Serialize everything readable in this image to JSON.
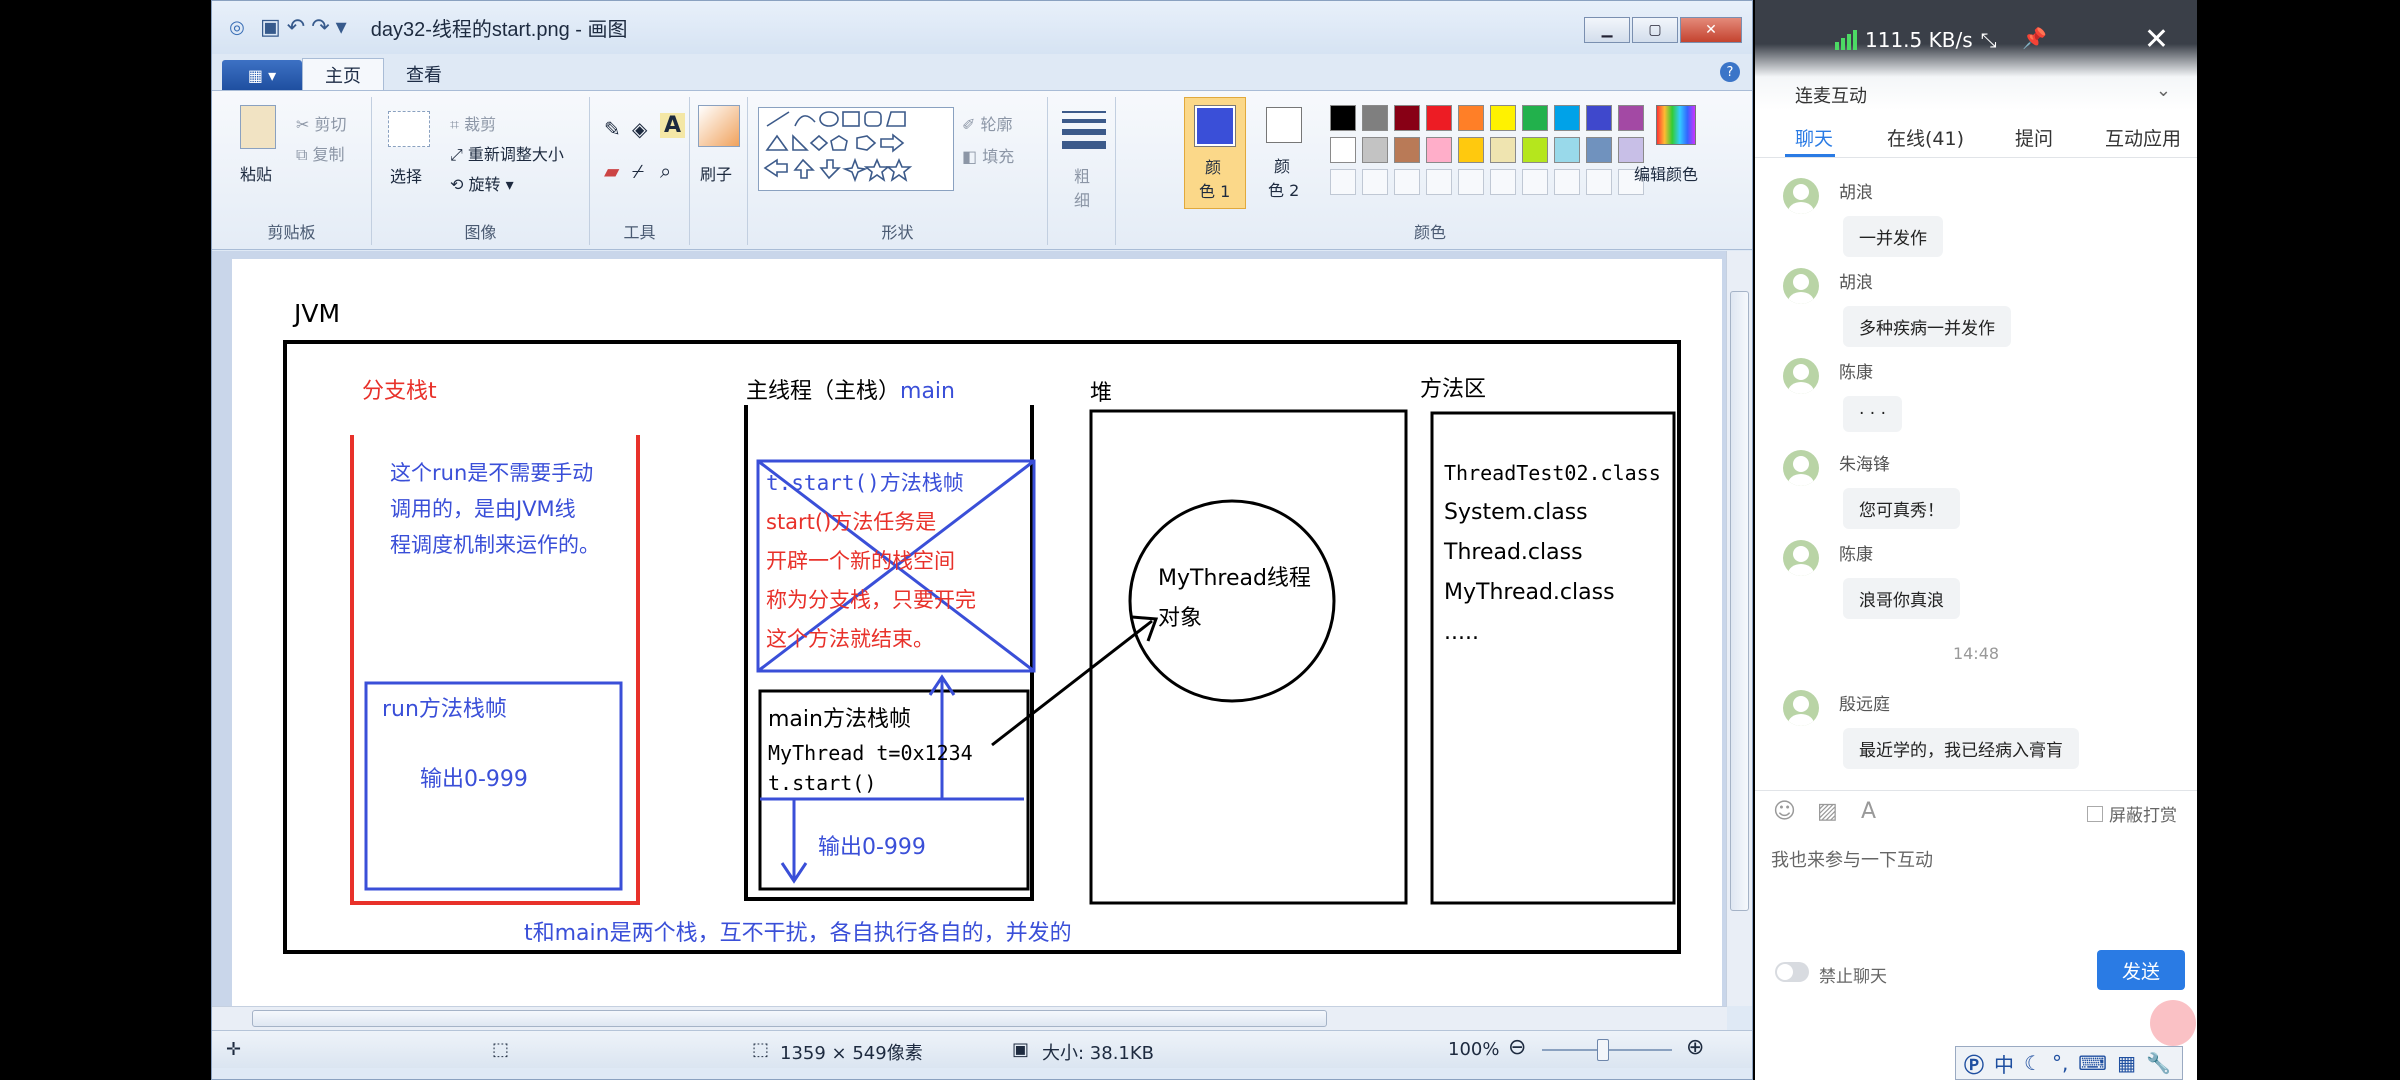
{
  "window": {
    "title": "day32-线程的start.png - 画图",
    "tabs": [
      "主页",
      "查看"
    ],
    "file_menu": "▦ ▾"
  },
  "ribbon": {
    "clipboard": {
      "label": "剪贴板",
      "paste": "粘贴",
      "cut": "剪切",
      "copy": "复制"
    },
    "image": {
      "label": "图像",
      "select": "选择",
      "crop": "裁剪",
      "resize": "重新调整大小",
      "rotate": "旋转"
    },
    "tools": {
      "label": "工具"
    },
    "brushes": {
      "label": "刷子"
    },
    "shapes": {
      "label": "形状",
      "outline": "轮廓",
      "fill": "填充"
    },
    "size": {
      "line1": "粗",
      "line2": "细"
    },
    "color1": {
      "line1": "颜",
      "line2": "色 1",
      "color": "#3a4fd8"
    },
    "color2": {
      "line1": "颜",
      "line2": "色 2"
    },
    "colors": {
      "label": "颜色",
      "edit": "编辑颜色"
    },
    "palette_row1": [
      "#000000",
      "#7f7f7f",
      "#880015",
      "#ed1c24",
      "#ff7f27",
      "#fff200",
      "#22b14c",
      "#00a2e8",
      "#3f48cc",
      "#a349a4"
    ],
    "palette_row2": [
      "#ffffff",
      "#c3c3c3",
      "#b97a57",
      "#ffaec9",
      "#ffc90e",
      "#efe4b0",
      "#b5e61d",
      "#99d9ea",
      "#7092be",
      "#c8bfe7"
    ]
  },
  "diagram": {
    "jvm": "JVM",
    "branch_stack_title": "分支栈t",
    "branch_note": [
      "这个run是不需要手动",
      "调用的，是由JVM线",
      "程调度机制来运作的。"
    ],
    "run_frame": "run方法栈帧",
    "run_output": "输出0-999",
    "main_title_a": "主线程（主栈）",
    "main_title_b": "main",
    "start_frame": "t.start()方法栈帧",
    "start_note": [
      "start()方法任务是",
      "开辟一个新的栈空间",
      "称为分支栈，只要开完",
      "这个方法就结束。"
    ],
    "main_frame": "main方法栈帧",
    "main_code1": "MyThread t=0x1234",
    "main_code2": "t.start()",
    "main_output": "输出0-999",
    "heap": "堆",
    "object_line1": "MyThread线程",
    "object_line2": "对象",
    "method_area": "方法区",
    "classes": [
      "ThreadTest02.class",
      "System.class",
      "Thread.class",
      "MyThread.class",
      "....."
    ],
    "footer": "t和main是两个栈，互不干扰，各自执行各自的，并发的"
  },
  "status": {
    "dimensions": "1359 × 549像素",
    "size": "大小: 38.1KB",
    "zoom": "100%"
  },
  "chat": {
    "net_speed": "111.5 KB/s",
    "lianmai": "连麦互动",
    "tabs": [
      "聊天",
      "在线(41)",
      "提问",
      "互动应用"
    ],
    "messages": [
      {
        "user": "胡浪",
        "text": "一并发作"
      },
      {
        "user": "胡浪",
        "text": "多种疾病一并发作"
      },
      {
        "user": "陈康",
        "text": "· · ·"
      },
      {
        "user": "朱海锋",
        "text": "您可真秀！"
      },
      {
        "user": "陈康",
        "text": "浪哥你真浪"
      }
    ],
    "time": "14:48",
    "last_message": {
      "user": "殷远庭",
      "text": "最近学的，我已经病入膏肓"
    },
    "shield_label": "屏蔽打赏",
    "input_placeholder": "我也来参与一下互动",
    "ban_label": "禁止聊天",
    "send": "发送"
  },
  "ime": {
    "label": "中"
  }
}
